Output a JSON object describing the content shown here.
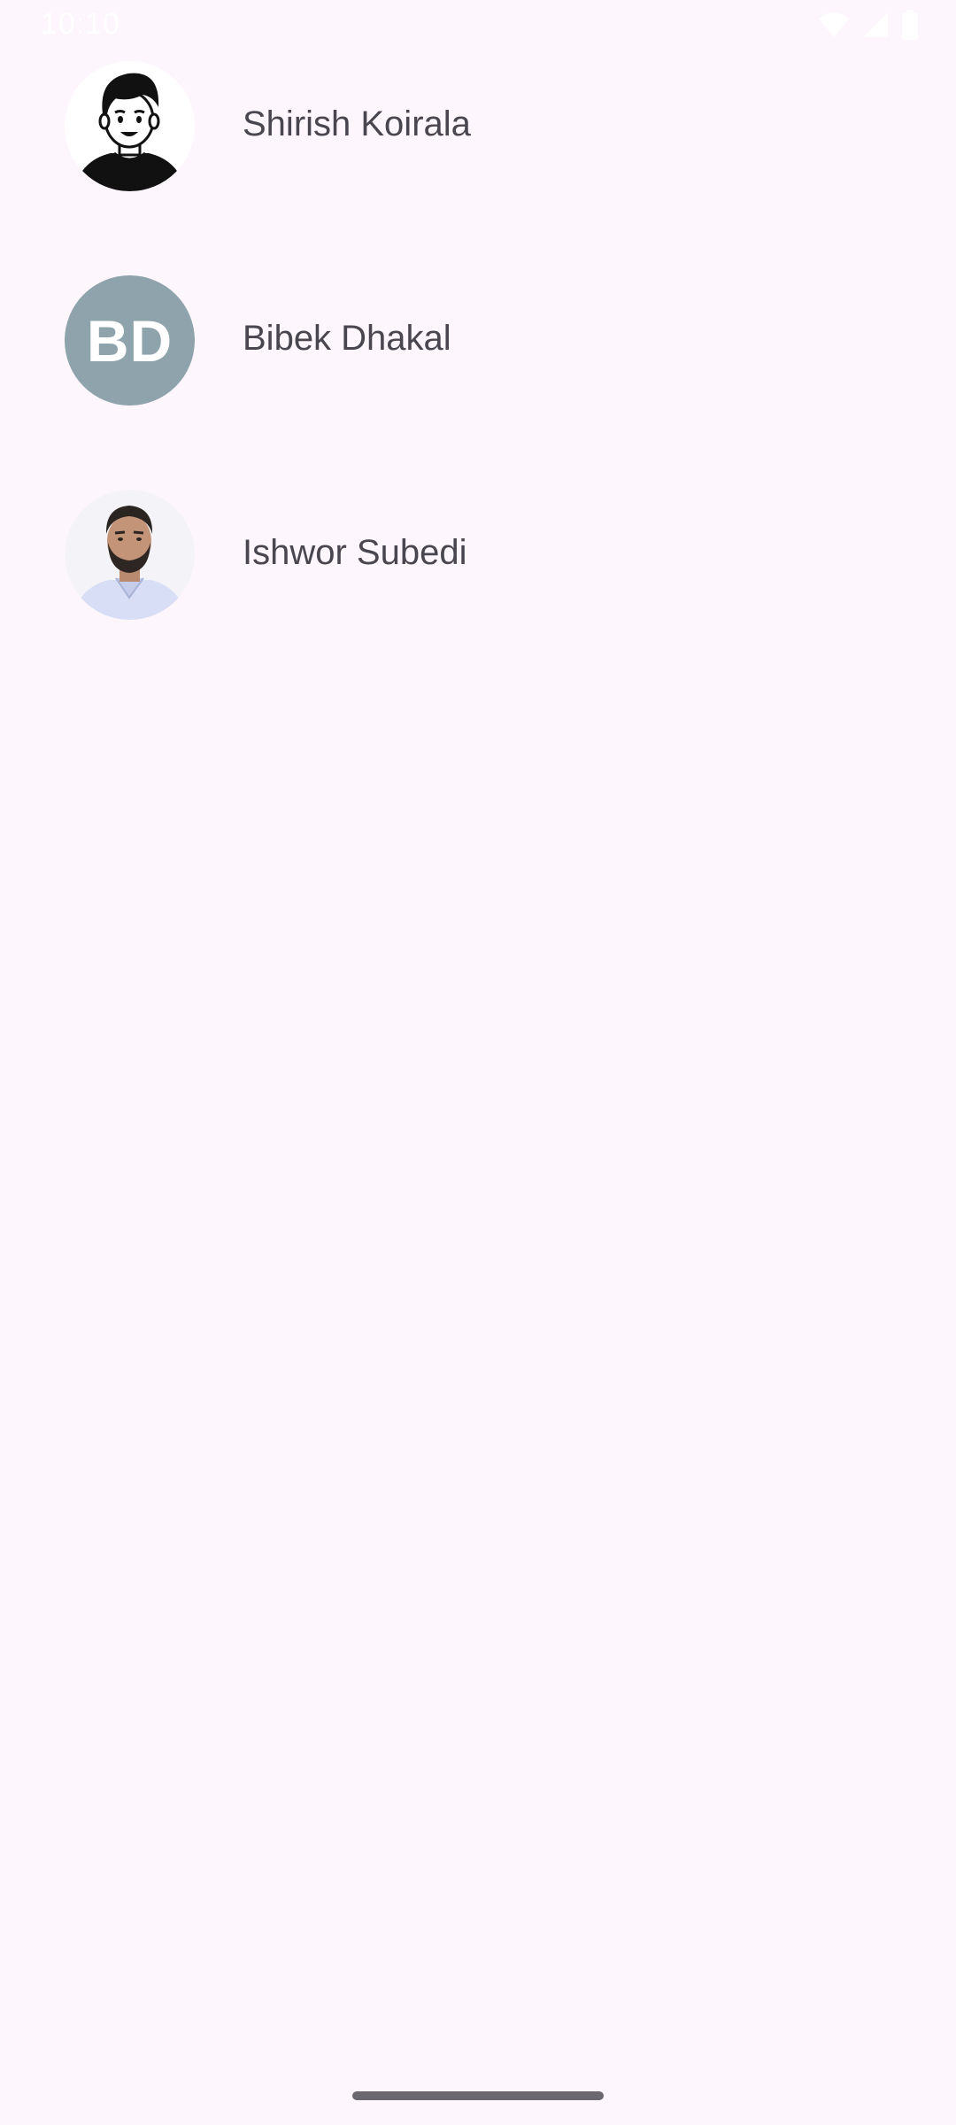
{
  "status_bar": {
    "time": "10:10",
    "icons": [
      "wifi-icon",
      "cell-signal-icon",
      "battery-icon"
    ]
  },
  "contacts": [
    {
      "name": "Shirish Koirala",
      "avatar": "cartoon-avatar",
      "initials": ""
    },
    {
      "name": "Bibek Dhakal",
      "avatar": "initials-avatar",
      "initials": "BD",
      "avatar_color": "#8fa3ad"
    },
    {
      "name": "Ishwor Subedi",
      "avatar": "photo-avatar",
      "initials": ""
    }
  ],
  "colors": {
    "background": "#fdf6fd",
    "name_text": "#4a4650",
    "home_indicator": "#6b676e"
  }
}
